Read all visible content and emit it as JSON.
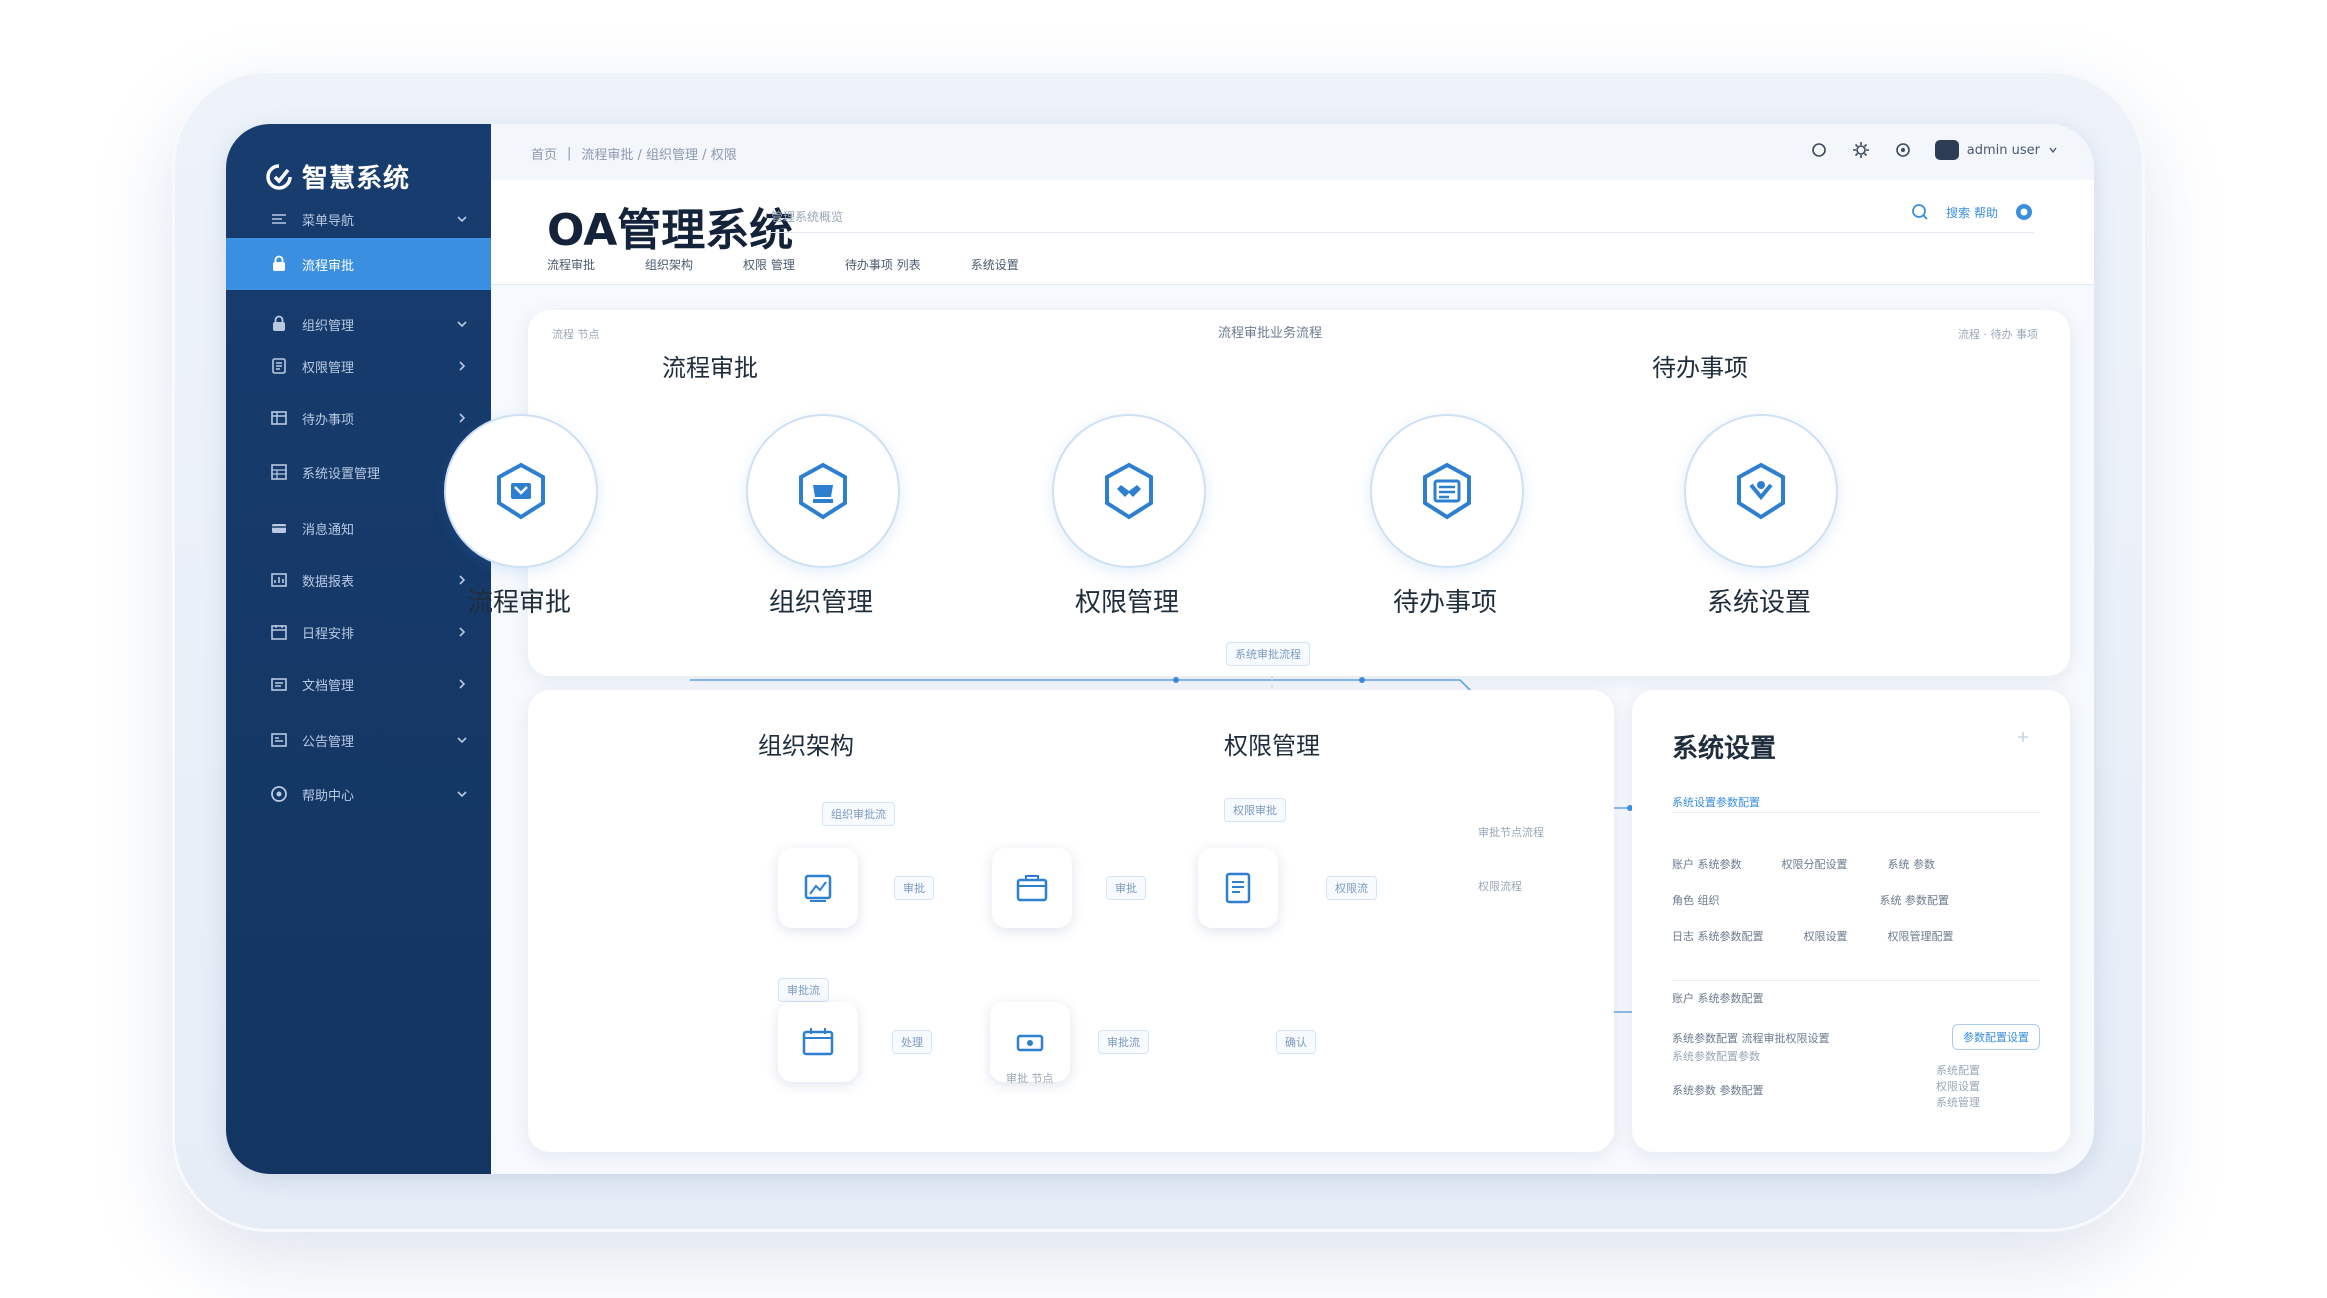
{
  "app": {
    "brand": "智慧系统",
    "title": "OA管理系统",
    "subtitle": "管理系统概览"
  },
  "topbar": {
    "breadcrumb": [
      "首页",
      "流程审批 / 组织管理 / 权限"
    ],
    "user_name": "admin user"
  },
  "sidebar": {
    "items": [
      {
        "label": "菜单导航",
        "icon": "menu-icon"
      },
      {
        "label": "流程审批",
        "icon": "lock-icon",
        "active": true
      },
      {
        "label": "组织管理",
        "icon": "lock-icon"
      },
      {
        "label": "权限管理",
        "icon": "doc-icon"
      },
      {
        "label": "待办事项",
        "icon": "table-icon"
      },
      {
        "label": "系统设置管理",
        "icon": "grid-icon"
      },
      {
        "label": "消息通知",
        "icon": "card-icon"
      },
      {
        "label": "数据报表",
        "icon": "chart-icon"
      },
      {
        "label": "日程安排",
        "icon": "calendar-icon"
      },
      {
        "label": "文档管理",
        "icon": "folder-icon"
      },
      {
        "label": "公告管理",
        "icon": "board-icon"
      },
      {
        "label": "帮助中心",
        "icon": "help-icon"
      }
    ]
  },
  "header": {
    "tabs": [
      "流程审批",
      "组织架构",
      "权限 管理",
      "待办事项 列表",
      "系统设置"
    ],
    "search_label": "搜索 帮助"
  },
  "flow": {
    "top_note": "流程审批业务流程",
    "left_note": "流程 节点",
    "right_note": "流程 · 待办 事项",
    "section_left": "流程审批",
    "section_right": "待办事项",
    "nodes": [
      {
        "label": "流程审批",
        "icon": "shield-box-icon"
      },
      {
        "label": "组织管理",
        "icon": "shield-cup-icon"
      },
      {
        "label": "权限管理",
        "icon": "shield-hands-icon"
      },
      {
        "label": "待办事项",
        "icon": "shield-list-icon"
      },
      {
        "label": "系统设置",
        "icon": "shield-gear-icon"
      }
    ],
    "bottom_tag": "系统审批流程"
  },
  "org": {
    "section_left": "组织架构",
    "section_right": "权限管理",
    "tag_a": "组织审批流",
    "tag_b": "权限审批",
    "tag_mid": "审批流",
    "steps_top": [
      "审批",
      "审批",
      "权限流"
    ],
    "steps_bottom": [
      "处理",
      "审批 节点",
      "审批流",
      "确认"
    ],
    "side_notes": [
      "审批节点流程",
      "权限流程"
    ]
  },
  "sys": {
    "title": "系统设置",
    "subtitle": "系统设置参数配置",
    "rows": [
      [
        "账户 系统参数",
        "权限分配设置",
        "系统 参数"
      ],
      [
        "角色 组织",
        "",
        "系统 参数配置"
      ],
      [
        "日志 系统参数配置",
        "权限设置",
        "权限管理配置"
      ]
    ],
    "sub_section": "账户 系统参数配置",
    "desc1": "系统参数配置 流程审批权限设置",
    "desc2": "系统参数配置参数",
    "desc3": "系统参数 参数配置",
    "button": "参数配置设置",
    "right_notes": [
      "系统配置",
      "权限设置",
      "系统管理"
    ]
  },
  "colors": {
    "sidebar": "#173c6e",
    "accent": "#3b8fe0",
    "line": "#8fb8e4"
  }
}
